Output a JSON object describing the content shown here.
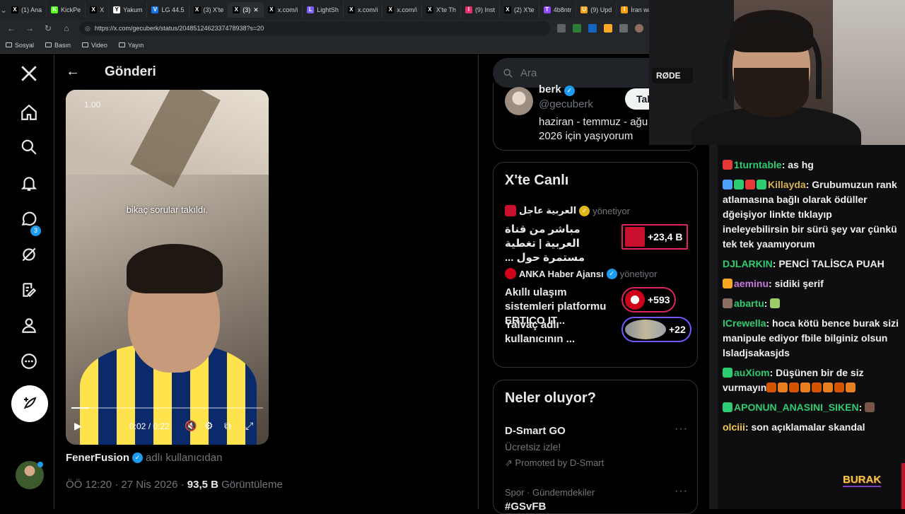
{
  "browser": {
    "tabs": [
      {
        "label": "(1) Ana",
        "color": "#000000",
        "glyph": "X"
      },
      {
        "label": "KickPe",
        "color": "#53fc18",
        "glyph": "K"
      },
      {
        "label": "X",
        "color": "#000000",
        "glyph": "X"
      },
      {
        "label": "Yakum",
        "color": "#ffffff",
        "glyph": "Y"
      },
      {
        "label": "LG 44.5",
        "color": "#1a73e8",
        "glyph": "V"
      },
      {
        "label": "(3) X'te",
        "color": "#000000",
        "glyph": "X"
      },
      {
        "label": "(3)",
        "color": "#000000",
        "glyph": "X",
        "active": true
      },
      {
        "label": "x.com/i",
        "color": "#000000",
        "glyph": "X"
      },
      {
        "label": "LightSh",
        "color": "#7b5cff",
        "glyph": "L"
      },
      {
        "label": "x.com/i",
        "color": "#000000",
        "glyph": "X"
      },
      {
        "label": "x.com/i",
        "color": "#000000",
        "glyph": "X"
      },
      {
        "label": "X'te Th",
        "color": "#000000",
        "glyph": "X"
      },
      {
        "label": "(9) Inst",
        "color": "#e1306c",
        "glyph": "I"
      },
      {
        "label": "(2) X'te",
        "color": "#000000",
        "glyph": "X"
      },
      {
        "label": "4b8ntr",
        "color": "#9146ff",
        "glyph": "T"
      },
      {
        "label": "(9) Upd",
        "color": "#f59e0b",
        "glyph": "U"
      },
      {
        "label": "İran wa",
        "color": "#f59e0b",
        "glyph": "İ"
      }
    ],
    "url": "https://x.com/gecuberk/status/2048512462337478938?s=20",
    "bookmarks": [
      "Sosyal",
      "Basın",
      "Video",
      "Yayın"
    ]
  },
  "nav": {
    "notifications_count": "3"
  },
  "post": {
    "header_title": "Gönderi",
    "video": {
      "speed": "1.00",
      "subtitle": "bikaç sorular takıldı.",
      "time": "0:02 / 0:22",
      "progress": 0.09
    },
    "attribution_name": "FenerFusion",
    "attribution_rest": "adlı kullanıcıdan",
    "time_date": "ÖÖ 12:20 · 27 Nis 2026 · ",
    "views_count": "93,5 B",
    "views_label": "Görüntüleme"
  },
  "sidebar": {
    "search_placeholder": "Ara",
    "profile": {
      "name": "berk",
      "handle": "@gecuberk",
      "button": "Tak",
      "bio": "haziran - temmuz - ağu 2026 için yaşıyorum"
    },
    "live": {
      "title": "X'te Canlı",
      "manager_label": "yönetiyor",
      "items": [
        {
          "host": "العربية عاجل",
          "title": "مباشر من قناة العربية | تغطية مستمرة حول ...",
          "count": "+23,4 B",
          "accent": "#e0245e"
        },
        {
          "host": "ANKA Haber Ajansı",
          "title": "Akıllı ulaşım sistemleri platformu ERTICO IT...",
          "count": "+593",
          "accent": "#e0245e"
        },
        {
          "host": "",
          "title": "Yalvaç adlı kullanıcının ...",
          "count": "+22",
          "accent": "#7856ff"
        }
      ]
    },
    "trends": {
      "title": "Neler oluyor?",
      "items": [
        {
          "title": "D-Smart GO",
          "subtitle": "Ücretsiz izle!",
          "promoted": "Promoted by D-Smart"
        },
        {
          "category": "Spor · Gündemdekiler",
          "title": "#GSvFB"
        }
      ]
    }
  },
  "webcam": {
    "mic_brand": "RØDE"
  },
  "chat": {
    "messages": [
      {
        "user": "1turntable",
        "color": "#2ecc71",
        "text": "as hg",
        "badges": [
          "#e53935"
        ]
      },
      {
        "user": "Killayda",
        "color": "#d4b24c",
        "text": "Grubumuzun rank atlamasına bağlı olarak ödüller dğeişiyor linkte tıklayıp ineleyebilirsin bir sürü şey var çünkü tek tek yaamıyorum",
        "badges": [
          "#4da3ff",
          "#2ecc71",
          "#e53935",
          "#2ecc71"
        ]
      },
      {
        "user": "DJLARKIN",
        "color": "#2ecc71",
        "text": "PENCİ TALİSCA PUAH",
        "badges": []
      },
      {
        "user": "aeminu",
        "color": "#c678dd",
        "text": "sidiki şerif",
        "badges": [
          "#f5a623"
        ]
      },
      {
        "user": "abartu",
        "color": "#2ecc71",
        "text": "",
        "badges": [
          "#8d6e63"
        ],
        "emotes": [
          "#9ccc65"
        ]
      },
      {
        "user": "ICrewella",
        "color": "#2ecc71",
        "text": "hoca kötü bence burak sizi manipule ediyor fbile bilginiz olsun lsladjsakasjds",
        "badges": []
      },
      {
        "user": "auXiom",
        "color": "#2ecc71",
        "text": "Düşünen bir de siz vurmayın",
        "badges": [
          "#2ecc71"
        ],
        "emotes": [
          "#d35400",
          "#e67e22",
          "#d35400",
          "#e67e22",
          "#d35400",
          "#e67e22",
          "#d35400",
          "#e67e22"
        ]
      },
      {
        "user": "APONUN_ANASINI_SIKEN",
        "color": "#2ecc71",
        "text": "",
        "badges": [
          "#2ecc71"
        ],
        "emotes": [
          "#795548"
        ]
      },
      {
        "user": "olciii",
        "color": "#f2c94c",
        "text": "son açıklamalar skandal",
        "badges": []
      }
    ],
    "overlay_name": "BURAK"
  }
}
